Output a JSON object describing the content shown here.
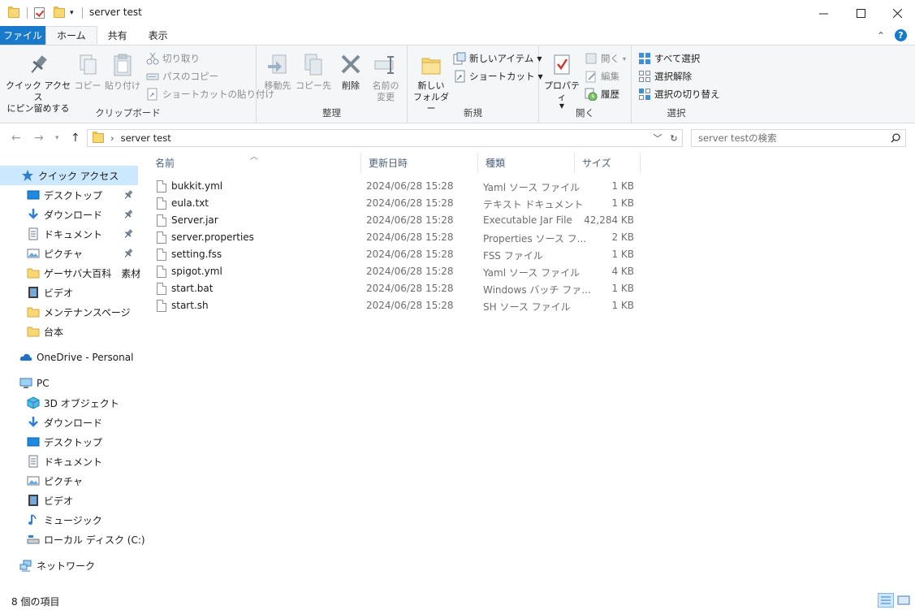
{
  "window": {
    "title": "server test",
    "minimize": "—",
    "maximize": "☐",
    "close": "✕"
  },
  "tabs": [
    "ファイル",
    "ホーム",
    "共有",
    "表示"
  ],
  "ribbon": {
    "clipboard": {
      "label": "クリップボード",
      "pin_quick_line1": "クイック アクセス",
      "pin_quick_line2": "にピン留めする",
      "copy": "コピー",
      "paste": "貼り付け",
      "cut": "切り取り",
      "copy_path": "パスのコピー",
      "paste_shortcut": "ショートカットの貼り付け"
    },
    "organize": {
      "label": "整理",
      "move_to": "移動先",
      "copy_to": "コピー先",
      "delete": "削除",
      "rename_line1": "名前の",
      "rename_line2": "変更"
    },
    "new": {
      "label": "新規",
      "new_folder_line1": "新しい",
      "new_folder_line2": "フォルダー",
      "new_item": "新しいアイテム",
      "shortcut": "ショートカット"
    },
    "open": {
      "label": "開く",
      "properties": "プロパティ",
      "open": "開く",
      "edit": "編集",
      "history": "履歴"
    },
    "select": {
      "label": "選択",
      "select_all": "すべて選択",
      "select_none": "選択解除",
      "invert": "選択の切り替え"
    }
  },
  "address": {
    "path": "server test",
    "search_placeholder": "server testの検索"
  },
  "nav": {
    "quick_access": "クイック アクセス",
    "quick_items": [
      {
        "label": "デスクトップ",
        "icon": "desktop-icon"
      },
      {
        "label": "ダウンロード",
        "icon": "download-icon"
      },
      {
        "label": "ドキュメント",
        "icon": "documents-icon"
      },
      {
        "label": "ピクチャ",
        "icon": "pictures-icon"
      },
      {
        "label": "ゲーサバ大百科　素材",
        "icon": "folder-icon"
      },
      {
        "label": "ビデオ",
        "icon": "video-icon"
      },
      {
        "label": "メンテナンスページ",
        "icon": "folder-icon"
      },
      {
        "label": "台本",
        "icon": "folder-icon"
      }
    ],
    "onedrive": "OneDrive - Personal",
    "pc": "PC",
    "pc_items": [
      {
        "label": "3D オブジェクト",
        "icon": "3d-objects-icon"
      },
      {
        "label": "ダウンロード",
        "icon": "download-icon"
      },
      {
        "label": "デスクトップ",
        "icon": "desktop-icon"
      },
      {
        "label": "ドキュメント",
        "icon": "documents-icon"
      },
      {
        "label": "ピクチャ",
        "icon": "pictures-icon"
      },
      {
        "label": "ビデオ",
        "icon": "video-icon"
      },
      {
        "label": "ミュージック",
        "icon": "music-icon"
      },
      {
        "label": "ローカル ディスク (C:)",
        "icon": "disk-icon"
      }
    ],
    "network": "ネットワーク"
  },
  "columns": {
    "name": "名前",
    "date": "更新日時",
    "type": "種類",
    "size": "サイズ"
  },
  "files": [
    {
      "name": "bukkit.yml",
      "date": "2024/06/28 15:28",
      "type": "Yaml ソース ファイル",
      "size": "1 KB"
    },
    {
      "name": "eula.txt",
      "date": "2024/06/28 15:28",
      "type": "テキスト ドキュメント",
      "size": "1 KB"
    },
    {
      "name": "Server.jar",
      "date": "2024/06/28 15:28",
      "type": "Executable Jar File",
      "size": "42,284 KB"
    },
    {
      "name": "server.properties",
      "date": "2024/06/28 15:28",
      "type": "Properties ソース フ...",
      "size": "2 KB"
    },
    {
      "name": "setting.fss",
      "date": "2024/06/28 15:28",
      "type": "FSS ファイル",
      "size": "1 KB"
    },
    {
      "name": "spigot.yml",
      "date": "2024/06/28 15:28",
      "type": "Yaml ソース ファイル",
      "size": "4 KB"
    },
    {
      "name": "start.bat",
      "date": "2024/06/28 15:28",
      "type": "Windows バッチ ファ...",
      "size": "1 KB"
    },
    {
      "name": "start.sh",
      "date": "2024/06/28 15:28",
      "type": "SH ソース ファイル",
      "size": "1 KB"
    }
  ],
  "status": {
    "item_count": "8 個の項目"
  }
}
